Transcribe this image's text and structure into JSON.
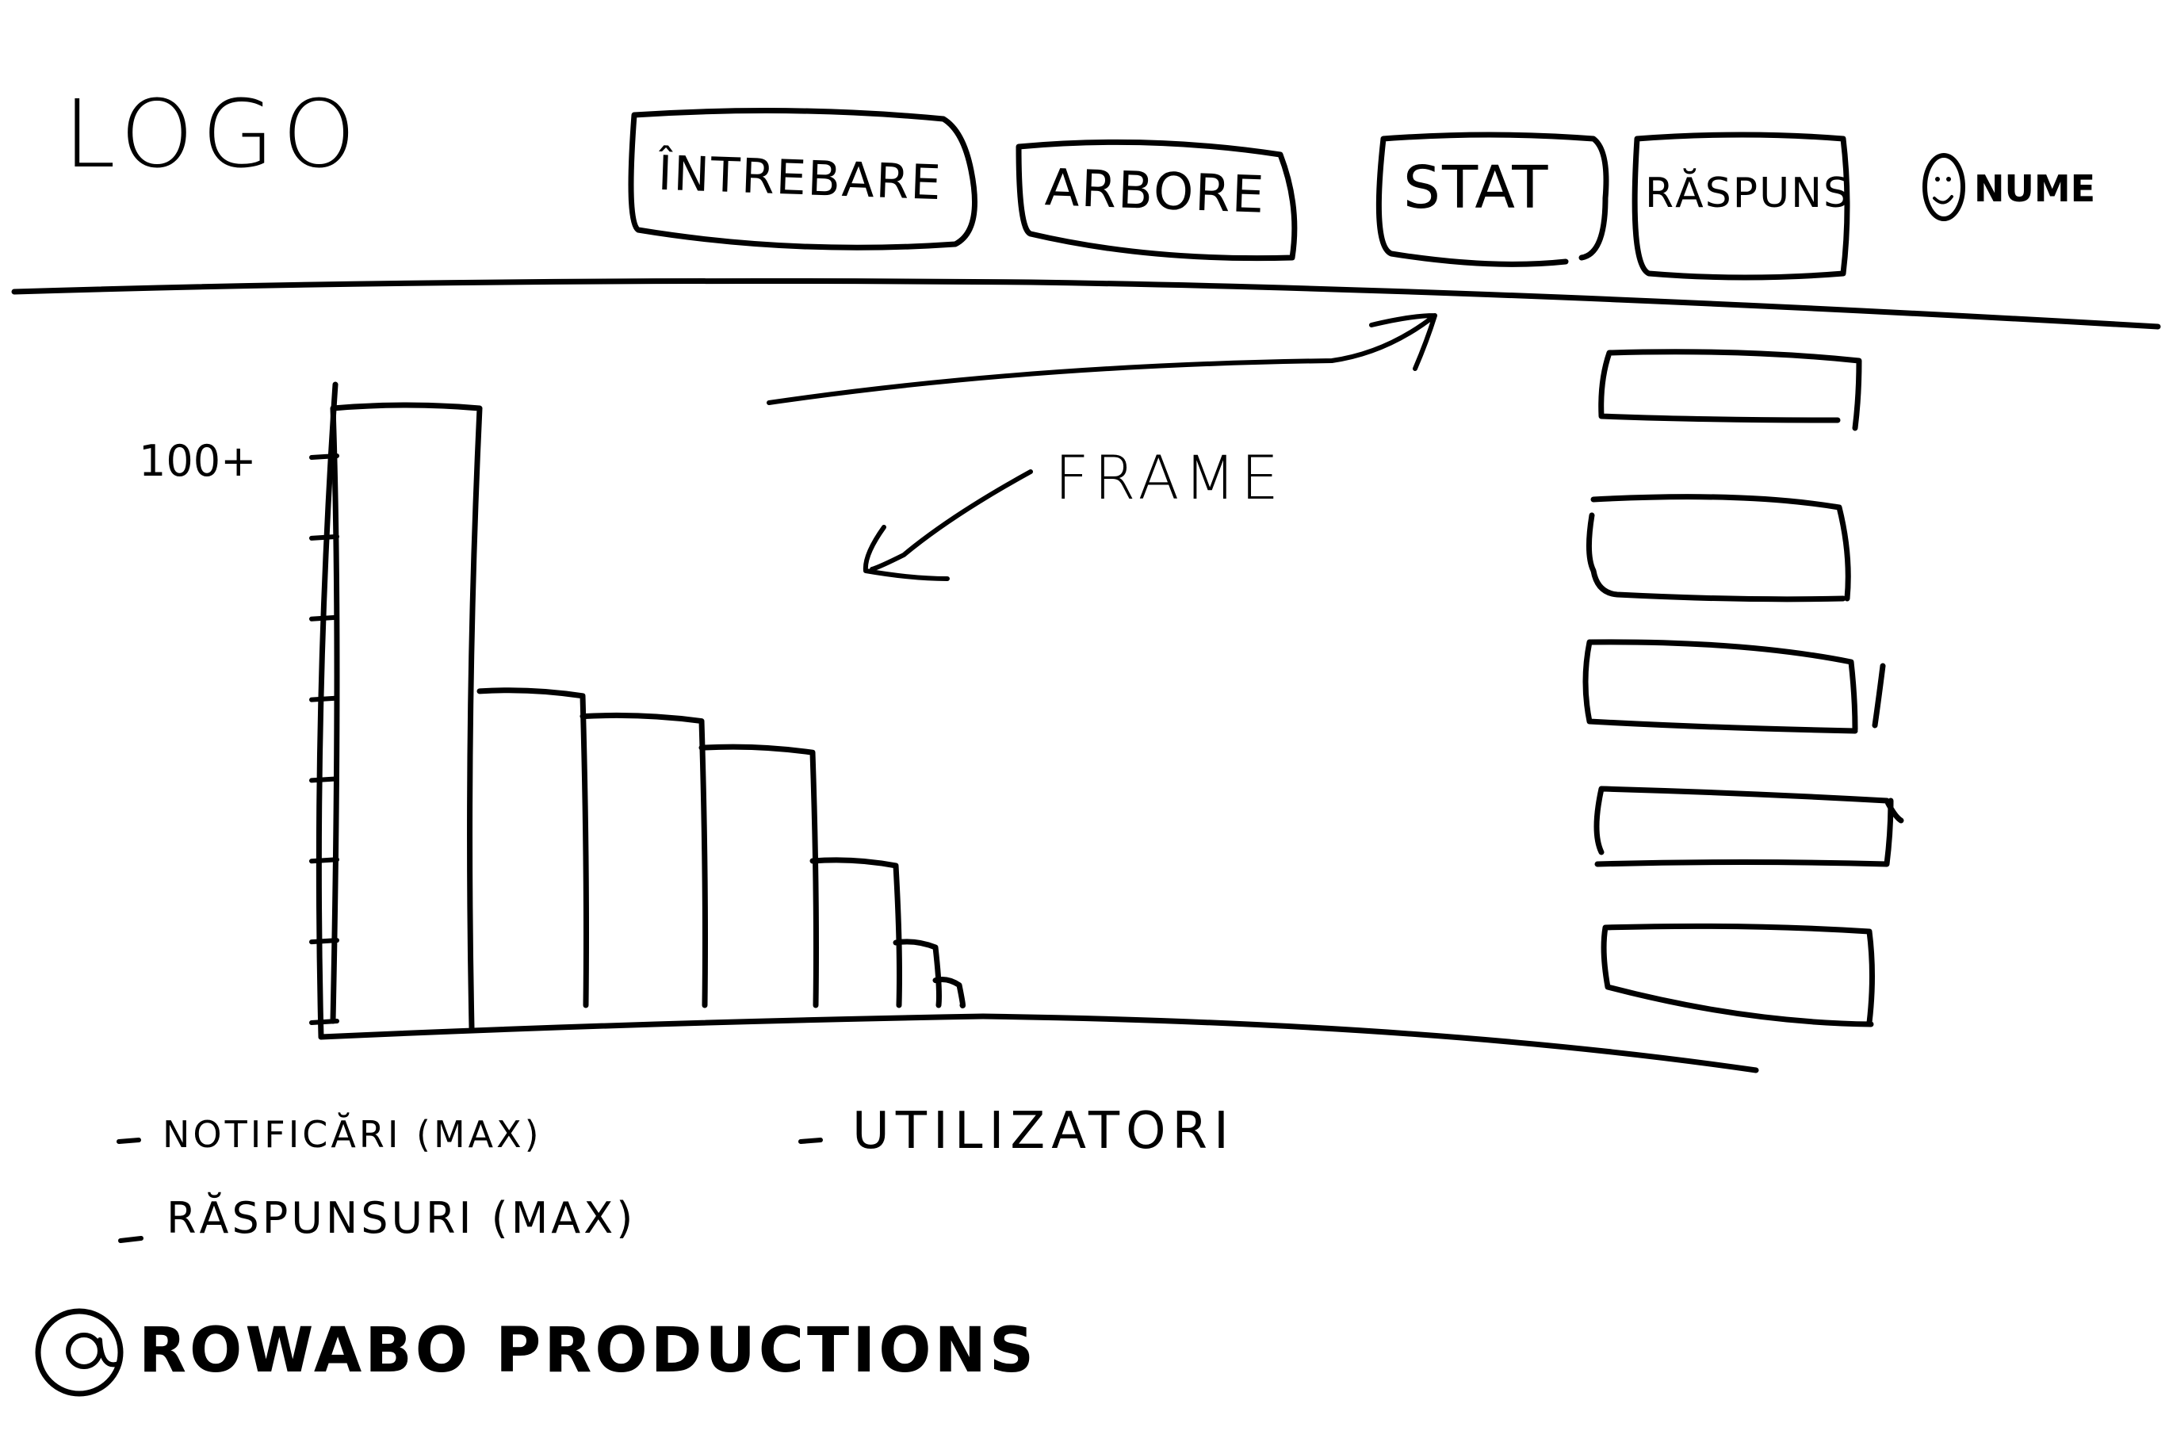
{
  "header": {
    "logo": "LOGO",
    "tabs": [
      {
        "label": "ÎNTREBARE"
      },
      {
        "label": "ARBORE"
      },
      {
        "label": "STAT"
      },
      {
        "label": "RĂSPUNS"
      }
    ],
    "user": {
      "name": "NUME",
      "avatar_icon": "smiley-face-icon"
    }
  },
  "annotation": {
    "label": "FRAME"
  },
  "legend": [
    "NOTIFICĂRI (MAX)",
    "RĂSPUNSURI (MAX)",
    "UTILIZATORI"
  ],
  "footer": {
    "credit": "ROWABO PRODUCTIONS",
    "at_icon": "at-sign-icon"
  },
  "side_panel": {
    "box_count_visible": 5
  },
  "chart_data": {
    "type": "bar",
    "title": "",
    "xlabel": "",
    "ylabel": "",
    "y_tick_label": "100+",
    "values": [
      100,
      55,
      51,
      46,
      28,
      15,
      9
    ],
    "ylim": [
      0,
      100
    ]
  }
}
